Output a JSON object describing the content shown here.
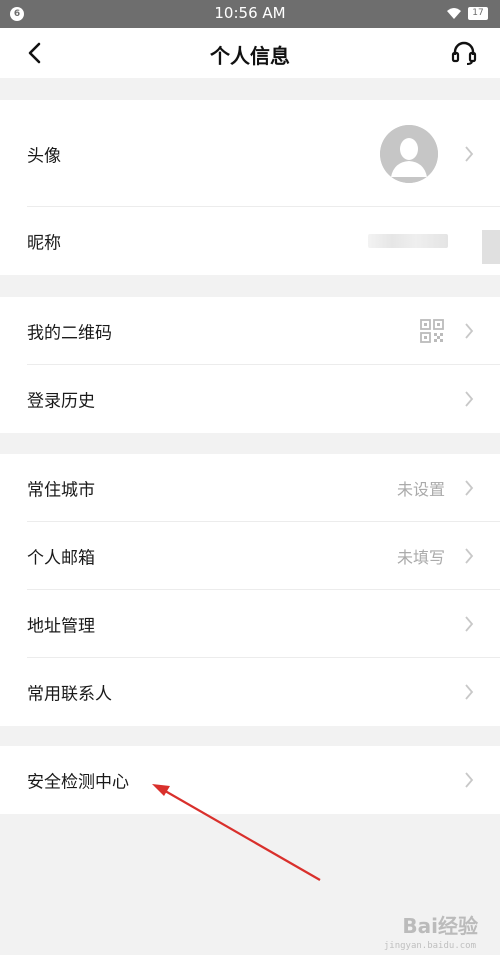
{
  "status_bar": {
    "badge": "6",
    "time": "10:56 AM",
    "battery": "17"
  },
  "nav": {
    "title": "个人信息",
    "back_icon": "chevron-left-icon",
    "service_icon": "headset-icon"
  },
  "group1": {
    "avatar_label": "头像",
    "nickname_label": "昵称"
  },
  "group2": {
    "qrcode_label": "我的二维码",
    "login_history_label": "登录历史"
  },
  "group3": {
    "city_label": "常住城市",
    "city_value": "未设置",
    "email_label": "个人邮箱",
    "email_value": "未填写",
    "address_label": "地址管理",
    "contacts_label": "常用联系人"
  },
  "group4": {
    "security_label": "安全检测中心"
  },
  "watermark": {
    "text": "Bai经验",
    "sub": "jingyan.baidu.com"
  },
  "colors": {
    "background": "#f2f2f2",
    "status_bar": "#6e6e6e",
    "annotation_arrow": "#d9302c",
    "secondary_text": "#aaaaaa"
  }
}
